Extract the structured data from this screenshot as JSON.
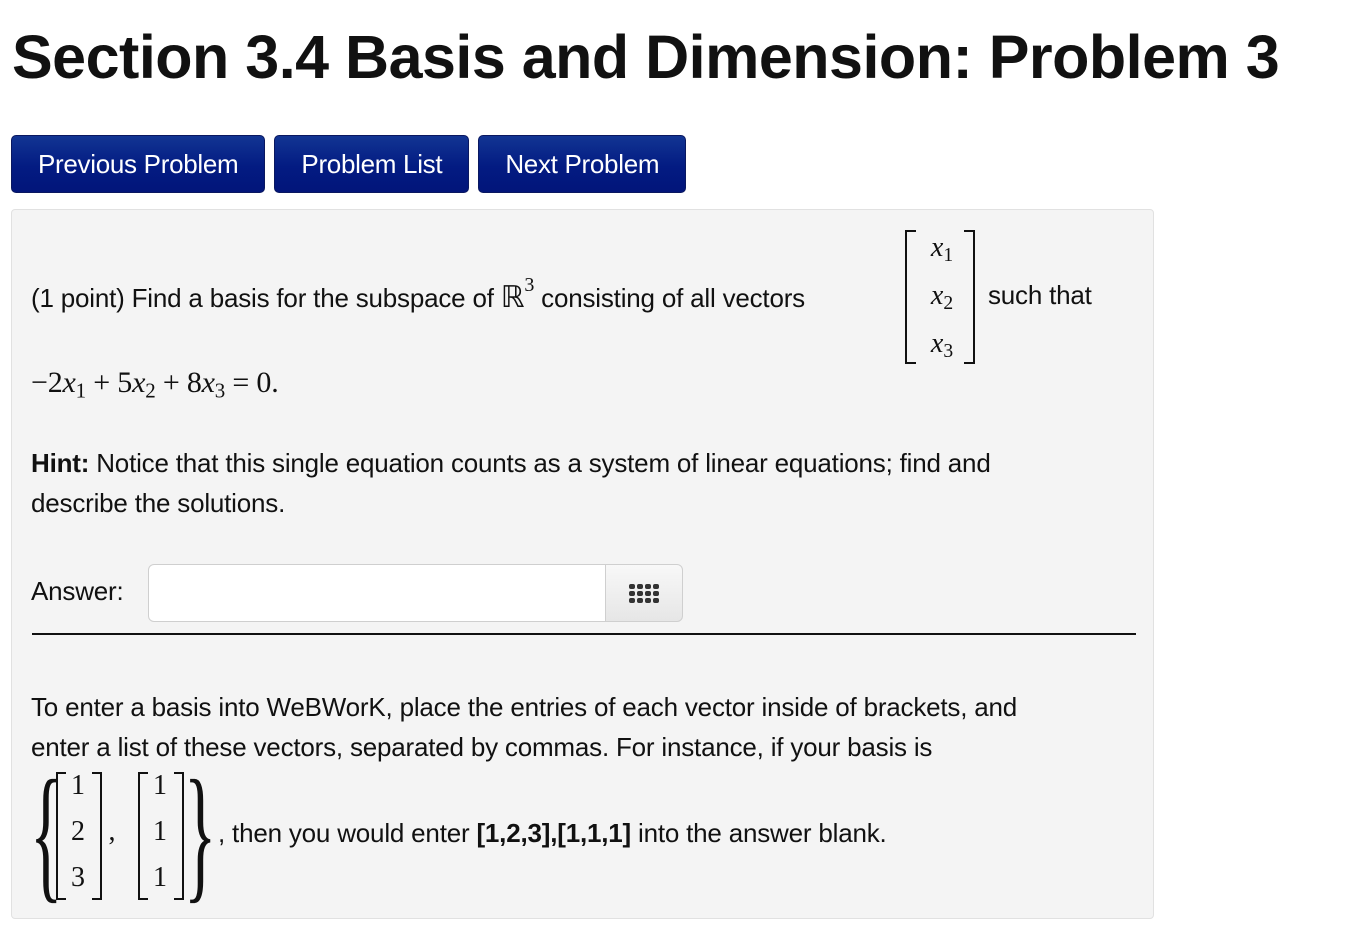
{
  "page": {
    "title": "Section 3.4 Basis and Dimension: Problem 3"
  },
  "nav": {
    "previous": "Previous Problem",
    "list": "Problem List",
    "next": "Next Problem"
  },
  "problem": {
    "intro_before": "(1 point) Find a basis for the subspace of ",
    "space_symbol": "ℝ",
    "space_dim": "3",
    "intro_after": " consisting of all vectors",
    "intro_end": "such that",
    "vector_entries": [
      "x",
      "x",
      "x"
    ],
    "vector_subs": [
      "1",
      "2",
      "3"
    ],
    "equation": {
      "terms": [
        "−2",
        "x",
        "1",
        " + 5",
        "x",
        "2",
        " + 8",
        "x",
        "3",
        " = 0."
      ]
    },
    "hint_label": "Hint:",
    "hint_text": " Notice that this single equation counts as a system of linear equations; find and",
    "hint_text_2": "describe the solutions.",
    "answer_label": "Answer:",
    "answer_value": "",
    "answer_placeholder": "",
    "instructions_1": "To enter a basis into WeBWorK, place the entries of each vector inside of brackets, and",
    "instructions_2": "enter a list of these vectors, separated by commas. For instance, if your basis is",
    "example_vectors": [
      [
        "1",
        "2",
        "3"
      ],
      [
        "1",
        "1",
        "1"
      ]
    ],
    "example_after": ", then you would enter ",
    "example_code": "[1,2,3],[1,1,1]",
    "example_end": " into the answer blank."
  },
  "icons": {
    "matrix_button": "grid-icon"
  },
  "colors": {
    "button_bg": "#031b82",
    "well_bg": "#f4f4f4"
  }
}
